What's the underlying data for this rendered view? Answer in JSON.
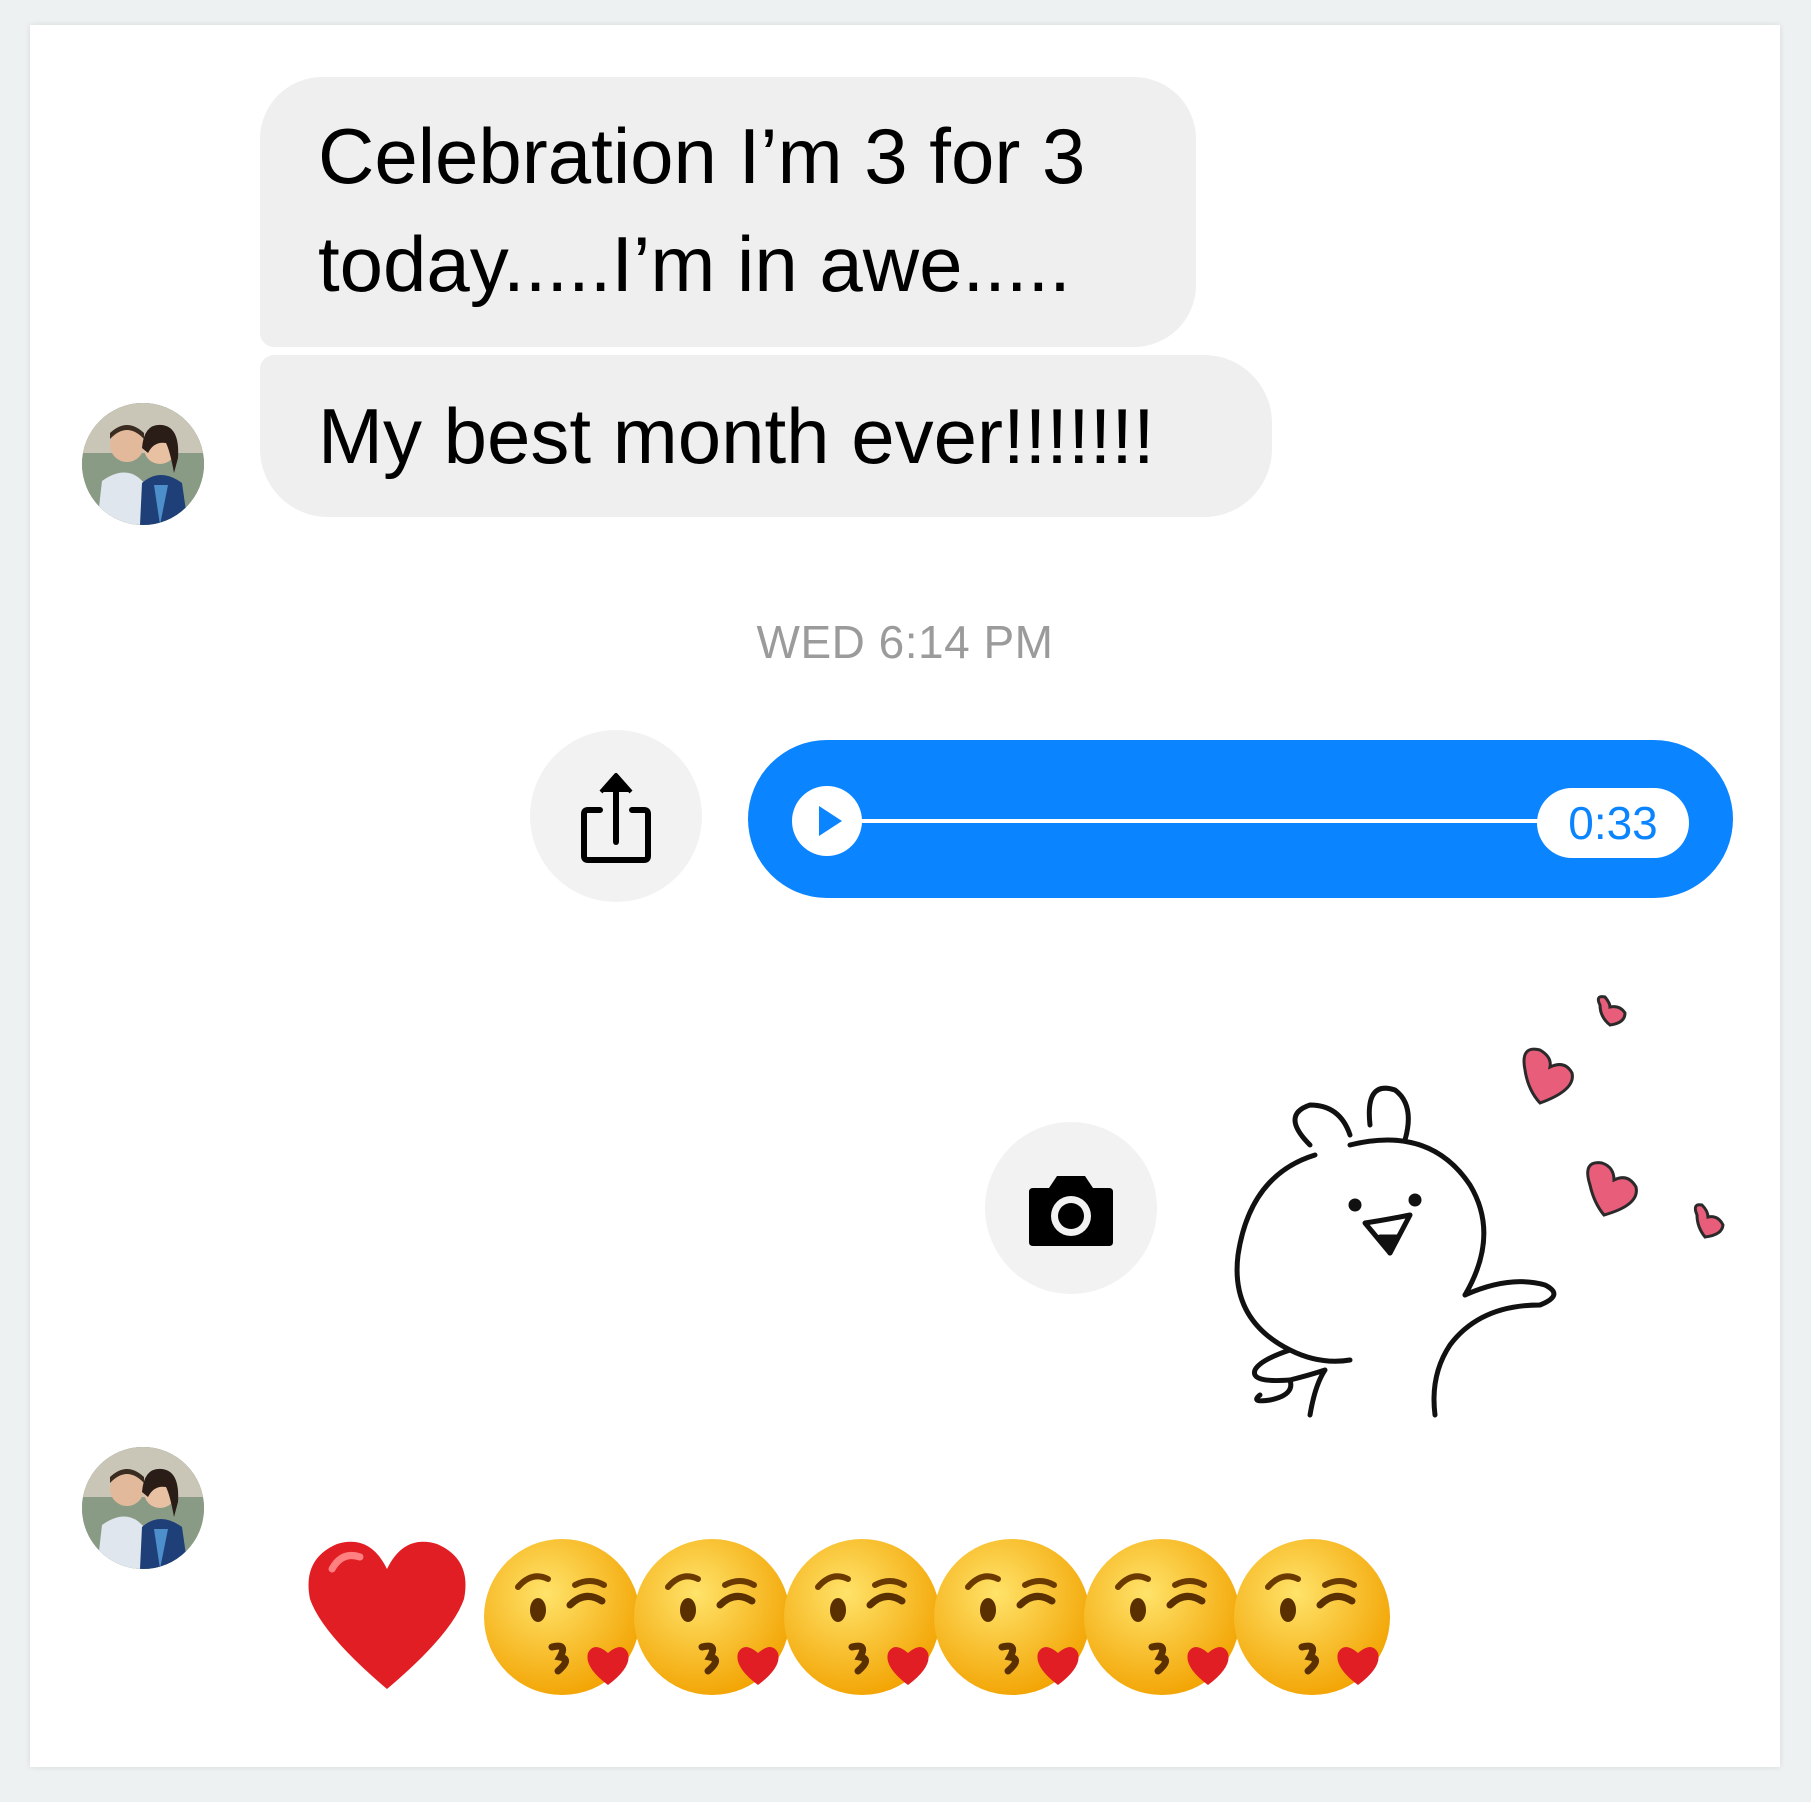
{
  "messages": {
    "incoming": [
      {
        "text_lines": [
          "Celebration I’m 3 for 3",
          "today.....I’m in awe....."
        ]
      },
      {
        "text": "My best month ever!!!!!!!"
      }
    ],
    "timestamp": "WED 6:14 PM",
    "audio": {
      "duration": "0:33",
      "progress": 0
    },
    "sticker": "bunny-blowing-hearts-sticker",
    "reaction_emojis": [
      "red-heart",
      "kissing-face-with-heart",
      "kissing-face-with-heart",
      "kissing-face-with-heart",
      "kissing-face-with-heart",
      "kissing-face-with-heart",
      "kissing-face-with-heart"
    ]
  },
  "icons": {
    "share": "share-icon",
    "camera": "camera-icon",
    "play": "play-icon"
  },
  "colors": {
    "incoming_bubble": "#efefef",
    "outgoing_bubble": "#0a84ff",
    "timestamp": "#9b9b9b",
    "heart": "#e85d7a"
  }
}
